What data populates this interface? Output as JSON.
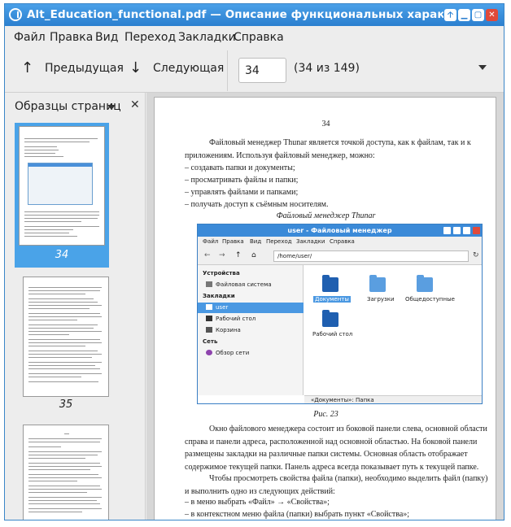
{
  "window": {
    "title": "Alt_Education_functional.pdf — Описание функциональных характеристик",
    "buttons": {
      "up": "🡡",
      "minimize": "▁",
      "maximize": "▢",
      "close": "✕"
    }
  },
  "menu": [
    "Файл",
    "Правка",
    "Вид",
    "Переход",
    "Закладки",
    "Справка"
  ],
  "toolbar": {
    "prev_label": "Предыдущая",
    "next_label": "Следующая",
    "prev_icon": "↑",
    "next_icon": "↓",
    "page_value": "34",
    "page_count": "(34 из 149)"
  },
  "sidebar": {
    "title": "Образцы страниц",
    "close": "✕",
    "thumbnails": [
      {
        "label": "34",
        "selected": true
      },
      {
        "label": "35",
        "selected": false
      }
    ]
  },
  "document": {
    "page_number": "34",
    "paragraphs": {
      "intro": "Файловый менеджер Thunar является точкой доступа, как к файлам, так и к приложениям. Используя файловый менеджер, можно:",
      "main": "Окно файлового менеджера состоит из боковой панели слева, основной области справа и панели адреса, расположенной над основной областью. На боковой панели размещены закладки на различные папки системы. Основная область отображает содержимое текущей папки. Панель адреса всегда показывает путь к текущей папке.",
      "props": "Чтобы просмотреть свойства файла (папки), необходимо выделить файл (папку) и выполнить одно из следующих действий:"
    },
    "bullets1": [
      "–    создавать папки и документы;",
      "–    просматривать файлы и папки;",
      "–    управлять файлами и папками;",
      "–    получать доступ к съёмным носителям."
    ],
    "figure_title": "Файловый менеджер Thunar",
    "figure_caption": "Рис. 23",
    "bullets2": [
      "–    в меню выбрать «Файл» → «Свойства»;",
      "–    в контекстном меню файла (папки) выбрать пункт «Свойства»;"
    ]
  },
  "screenshot": {
    "title": "user - Файловый менеджер",
    "menu": [
      "Файл",
      "Правка",
      "Вид",
      "Переход",
      "Закладки",
      "Справка"
    ],
    "path": "/home/user/",
    "sections": {
      "devices": "Устройства",
      "bookmarks": "Закладки",
      "network": "Сеть"
    },
    "items": {
      "filesystem": "Файловая система",
      "user": "user",
      "desktop": "Рабочий стол",
      "trash": "Корзина",
      "network_browse": "Обзор сети"
    },
    "folders": {
      "documents": "Документы",
      "downloads": "Загрузки",
      "public": "Общедоступные",
      "desktop": "Рабочий стол"
    },
    "status": "«Документы»: Папка",
    "colors": {
      "titlebar": "#3b8ad8",
      "selection": "#4a98e2",
      "folder_dark": "#1f5fb0",
      "folder_light": "#5a9ee0"
    }
  }
}
